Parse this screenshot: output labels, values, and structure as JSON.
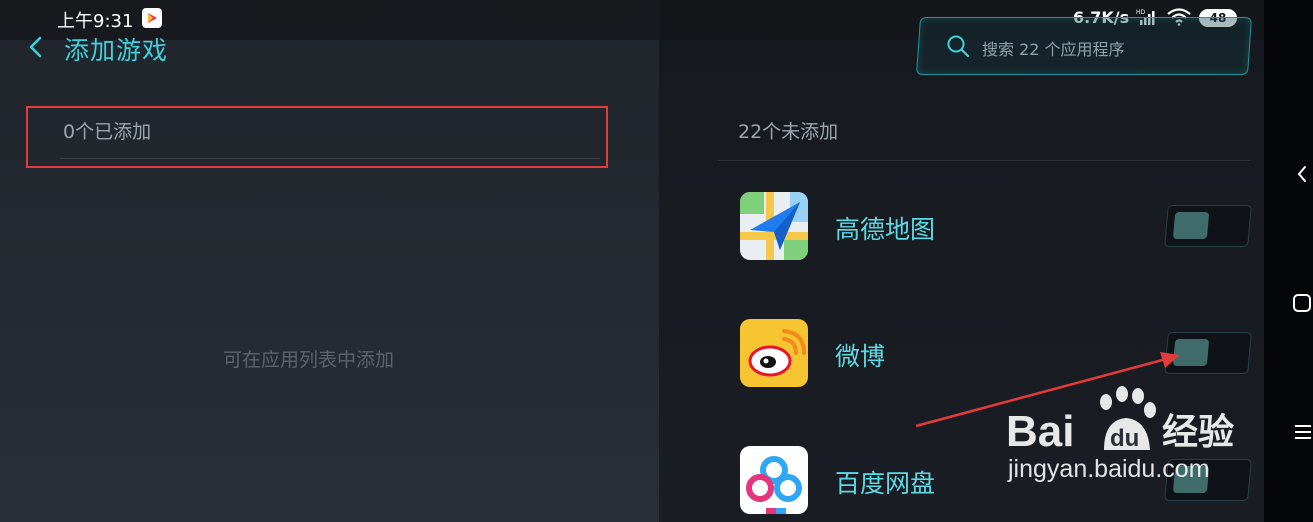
{
  "status_bar": {
    "time": "上午9:31",
    "net_speed": "6.7K/s",
    "battery": "48"
  },
  "header": {
    "title": "添加游戏"
  },
  "search": {
    "placeholder": "搜索 22 个应用程序"
  },
  "added": {
    "count_label": "0个已添加",
    "empty_hint": "可在应用列表中添加"
  },
  "unadded": {
    "count_label": "22个未添加",
    "apps": [
      {
        "name": "高德地图",
        "icon": "amap-icon",
        "enabled": false
      },
      {
        "name": "微博",
        "icon": "weibo-icon",
        "enabled": false
      },
      {
        "name": "百度网盘",
        "icon": "baidu-netdisk-icon",
        "enabled": false
      }
    ]
  },
  "watermark": {
    "text": "jingyan.baidu.com",
    "logo_text": "Bai du 经验"
  },
  "colors": {
    "accent": "#3fd0dc",
    "annotation": "#e33a3a"
  }
}
